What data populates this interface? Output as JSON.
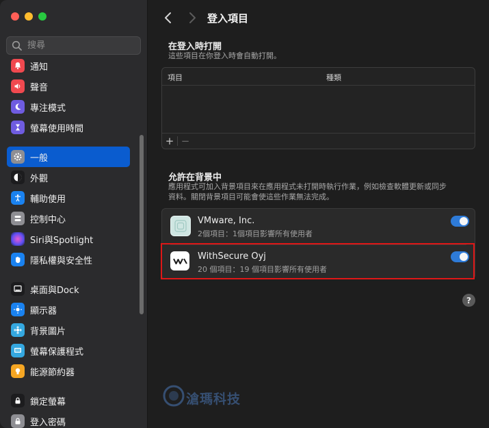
{
  "sidebar": {
    "search_placeholder": "搜尋",
    "items": [
      {
        "label": "通知",
        "icon": "bell-icon",
        "color": "#f0494f"
      },
      {
        "label": "聲音",
        "icon": "speaker-icon",
        "color": "#f0494f"
      },
      {
        "label": "專注模式",
        "icon": "moon-icon",
        "color": "#6f5ce0"
      },
      {
        "label": "螢幕使用時間",
        "icon": "hourglass-icon",
        "color": "#6f5ce0"
      },
      {
        "label": "一般",
        "icon": "gear-icon",
        "color": "#8e8e93",
        "selected": true
      },
      {
        "label": "外觀",
        "icon": "appearance-icon",
        "color": "#1c1c1e"
      },
      {
        "label": "輔助使用",
        "icon": "accessibility-icon",
        "color": "#1a82f0"
      },
      {
        "label": "控制中心",
        "icon": "control-center-icon",
        "color": "#8e8e93"
      },
      {
        "label": "Siri與Spotlight",
        "icon": "siri-icon",
        "color": "#b34fd6"
      },
      {
        "label": "隱私權與安全性",
        "icon": "hand-icon",
        "color": "#1a82f0"
      },
      {
        "label": "桌面與Dock",
        "icon": "dock-icon",
        "color": "#1c1c1e"
      },
      {
        "label": "顯示器",
        "icon": "sun-icon",
        "color": "#1a82f0"
      },
      {
        "label": "背景圖片",
        "icon": "wallpaper-icon",
        "color": "#35a8e0"
      },
      {
        "label": "螢幕保護程式",
        "icon": "screensaver-icon",
        "color": "#35a8e0"
      },
      {
        "label": "能源節約器",
        "icon": "bulb-icon",
        "color": "#f5a623"
      },
      {
        "label": "鎖定螢幕",
        "icon": "lock-screen-icon",
        "color": "#1c1c1e"
      },
      {
        "label": "登入密碼",
        "icon": "lock-icon",
        "color": "#8e8e93"
      }
    ]
  },
  "header": {
    "title": "登入項目"
  },
  "open_at_login": {
    "title": "在登入時打開",
    "subtitle": "這些項目在你登入時會自動打開。",
    "col_item": "項目",
    "col_kind": "種類",
    "add_label": "+",
    "remove_label": "−"
  },
  "background": {
    "title": "允許在背景中",
    "subtitle_line1": "應用程式可加入背景項目來在應用程式未打開時執行作業，例如檢查軟體更新或同步",
    "subtitle_line2": "資料。關閉背景項目可能會使這些作業無法完成。",
    "items": [
      {
        "name": "VMware, Inc.",
        "detail": "2個項目：1個項目影響所有使用者",
        "enabled": true
      },
      {
        "name": "WithSecure Oyj",
        "detail": "20 個項目：19 個項目影響所有使用者",
        "enabled": true
      }
    ]
  },
  "help_label": "?",
  "watermark": "滄瑪科技",
  "colors": {
    "accent": "#0a5ccf",
    "toggle_on": "#2e7bd8",
    "highlight": "#e01717"
  }
}
